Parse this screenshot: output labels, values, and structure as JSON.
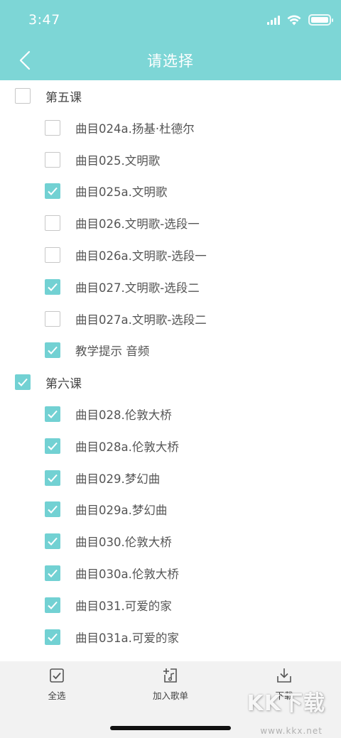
{
  "status_bar": {
    "time": "3:47"
  },
  "header": {
    "title": "请选择"
  },
  "colors": {
    "accent": "#7dd6d6",
    "checkbox": "#72d1d3",
    "bar": "#f2f2f2"
  },
  "list": [
    {
      "label": "第五课",
      "checked": false,
      "level": "group"
    },
    {
      "label": "曲目024a.扬基·杜德尔",
      "checked": false,
      "level": "child"
    },
    {
      "label": "曲目025.文明歌",
      "checked": false,
      "level": "child"
    },
    {
      "label": "曲目025a.文明歌",
      "checked": true,
      "level": "child"
    },
    {
      "label": "曲目026.文明歌-选段一",
      "checked": false,
      "level": "child"
    },
    {
      "label": "曲目026a.文明歌-选段一",
      "checked": false,
      "level": "child"
    },
    {
      "label": "曲目027.文明歌-选段二",
      "checked": true,
      "level": "child"
    },
    {
      "label": "曲目027a.文明歌-选段二",
      "checked": false,
      "level": "child"
    },
    {
      "label": "教学提示 音频",
      "checked": true,
      "level": "child"
    },
    {
      "label": "第六课",
      "checked": true,
      "level": "group"
    },
    {
      "label": "曲目028.伦敦大桥",
      "checked": true,
      "level": "child"
    },
    {
      "label": "曲目028a.伦敦大桥",
      "checked": true,
      "level": "child"
    },
    {
      "label": "曲目029.梦幻曲",
      "checked": true,
      "level": "child"
    },
    {
      "label": "曲目029a.梦幻曲",
      "checked": true,
      "level": "child"
    },
    {
      "label": "曲目030.伦敦大桥",
      "checked": true,
      "level": "child"
    },
    {
      "label": "曲目030a.伦敦大桥",
      "checked": true,
      "level": "child"
    },
    {
      "label": "曲目031.可爱的家",
      "checked": true,
      "level": "child"
    },
    {
      "label": "曲目031a.可爱的家",
      "checked": true,
      "level": "child"
    }
  ],
  "bottom_bar": {
    "select_all": {
      "label": "全选",
      "icon": "checkbox-check-icon"
    },
    "add_playlist": {
      "label": "加入歌单",
      "icon": "add-playlist-icon"
    },
    "download": {
      "label": "下载",
      "icon": "download-icon"
    }
  },
  "watermark": {
    "text": "KK下载",
    "url": "www.kkx.net"
  }
}
